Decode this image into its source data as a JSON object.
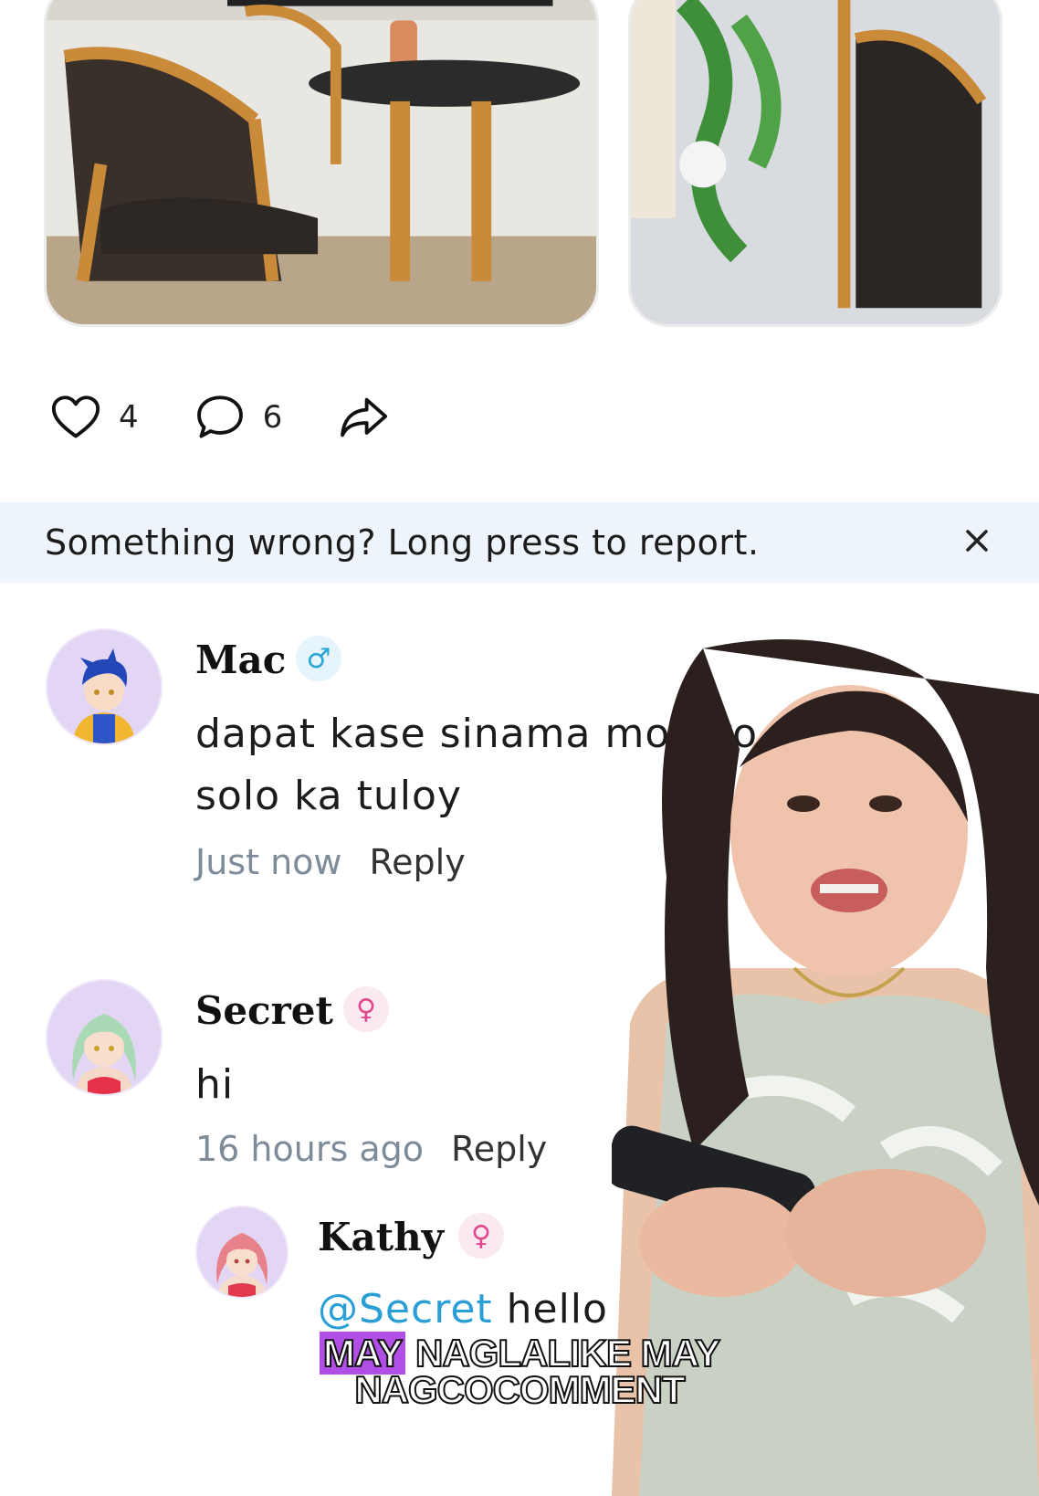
{
  "post": {
    "like_count": "4",
    "comment_count": "6",
    "icons": {
      "like": "heart-icon",
      "comment": "comment-bubble-icon",
      "share": "share-arrow-icon"
    }
  },
  "report_bar": {
    "text": "Something wrong? Long press to report.",
    "close_icon": "close-icon"
  },
  "comments": [
    {
      "username": "Mac",
      "gender_symbol": "♂",
      "gender_color": "#2aa6d6",
      "text_line1": "dapat kase sinama mo ako",
      "text_line2": "solo ka tuloy",
      "time": "Just now",
      "reply_label": "Reply"
    },
    {
      "username": "Secret",
      "gender_symbol": "♀",
      "gender_color": "#e0488b",
      "text_line1": "hi",
      "time": "16 hours ago",
      "reply_label": "Reply"
    }
  ],
  "reply": {
    "username": "Kathy",
    "gender_symbol": "♀",
    "gender_color": "#e0488b",
    "mention": "@Secret",
    "text": " hello"
  },
  "caption": {
    "highlight": "MAY",
    "line1_rest": " NAGLALIKE MAY",
    "line2": "NAGCOCOMMENT",
    "highlight_color": "#b04ee6"
  }
}
